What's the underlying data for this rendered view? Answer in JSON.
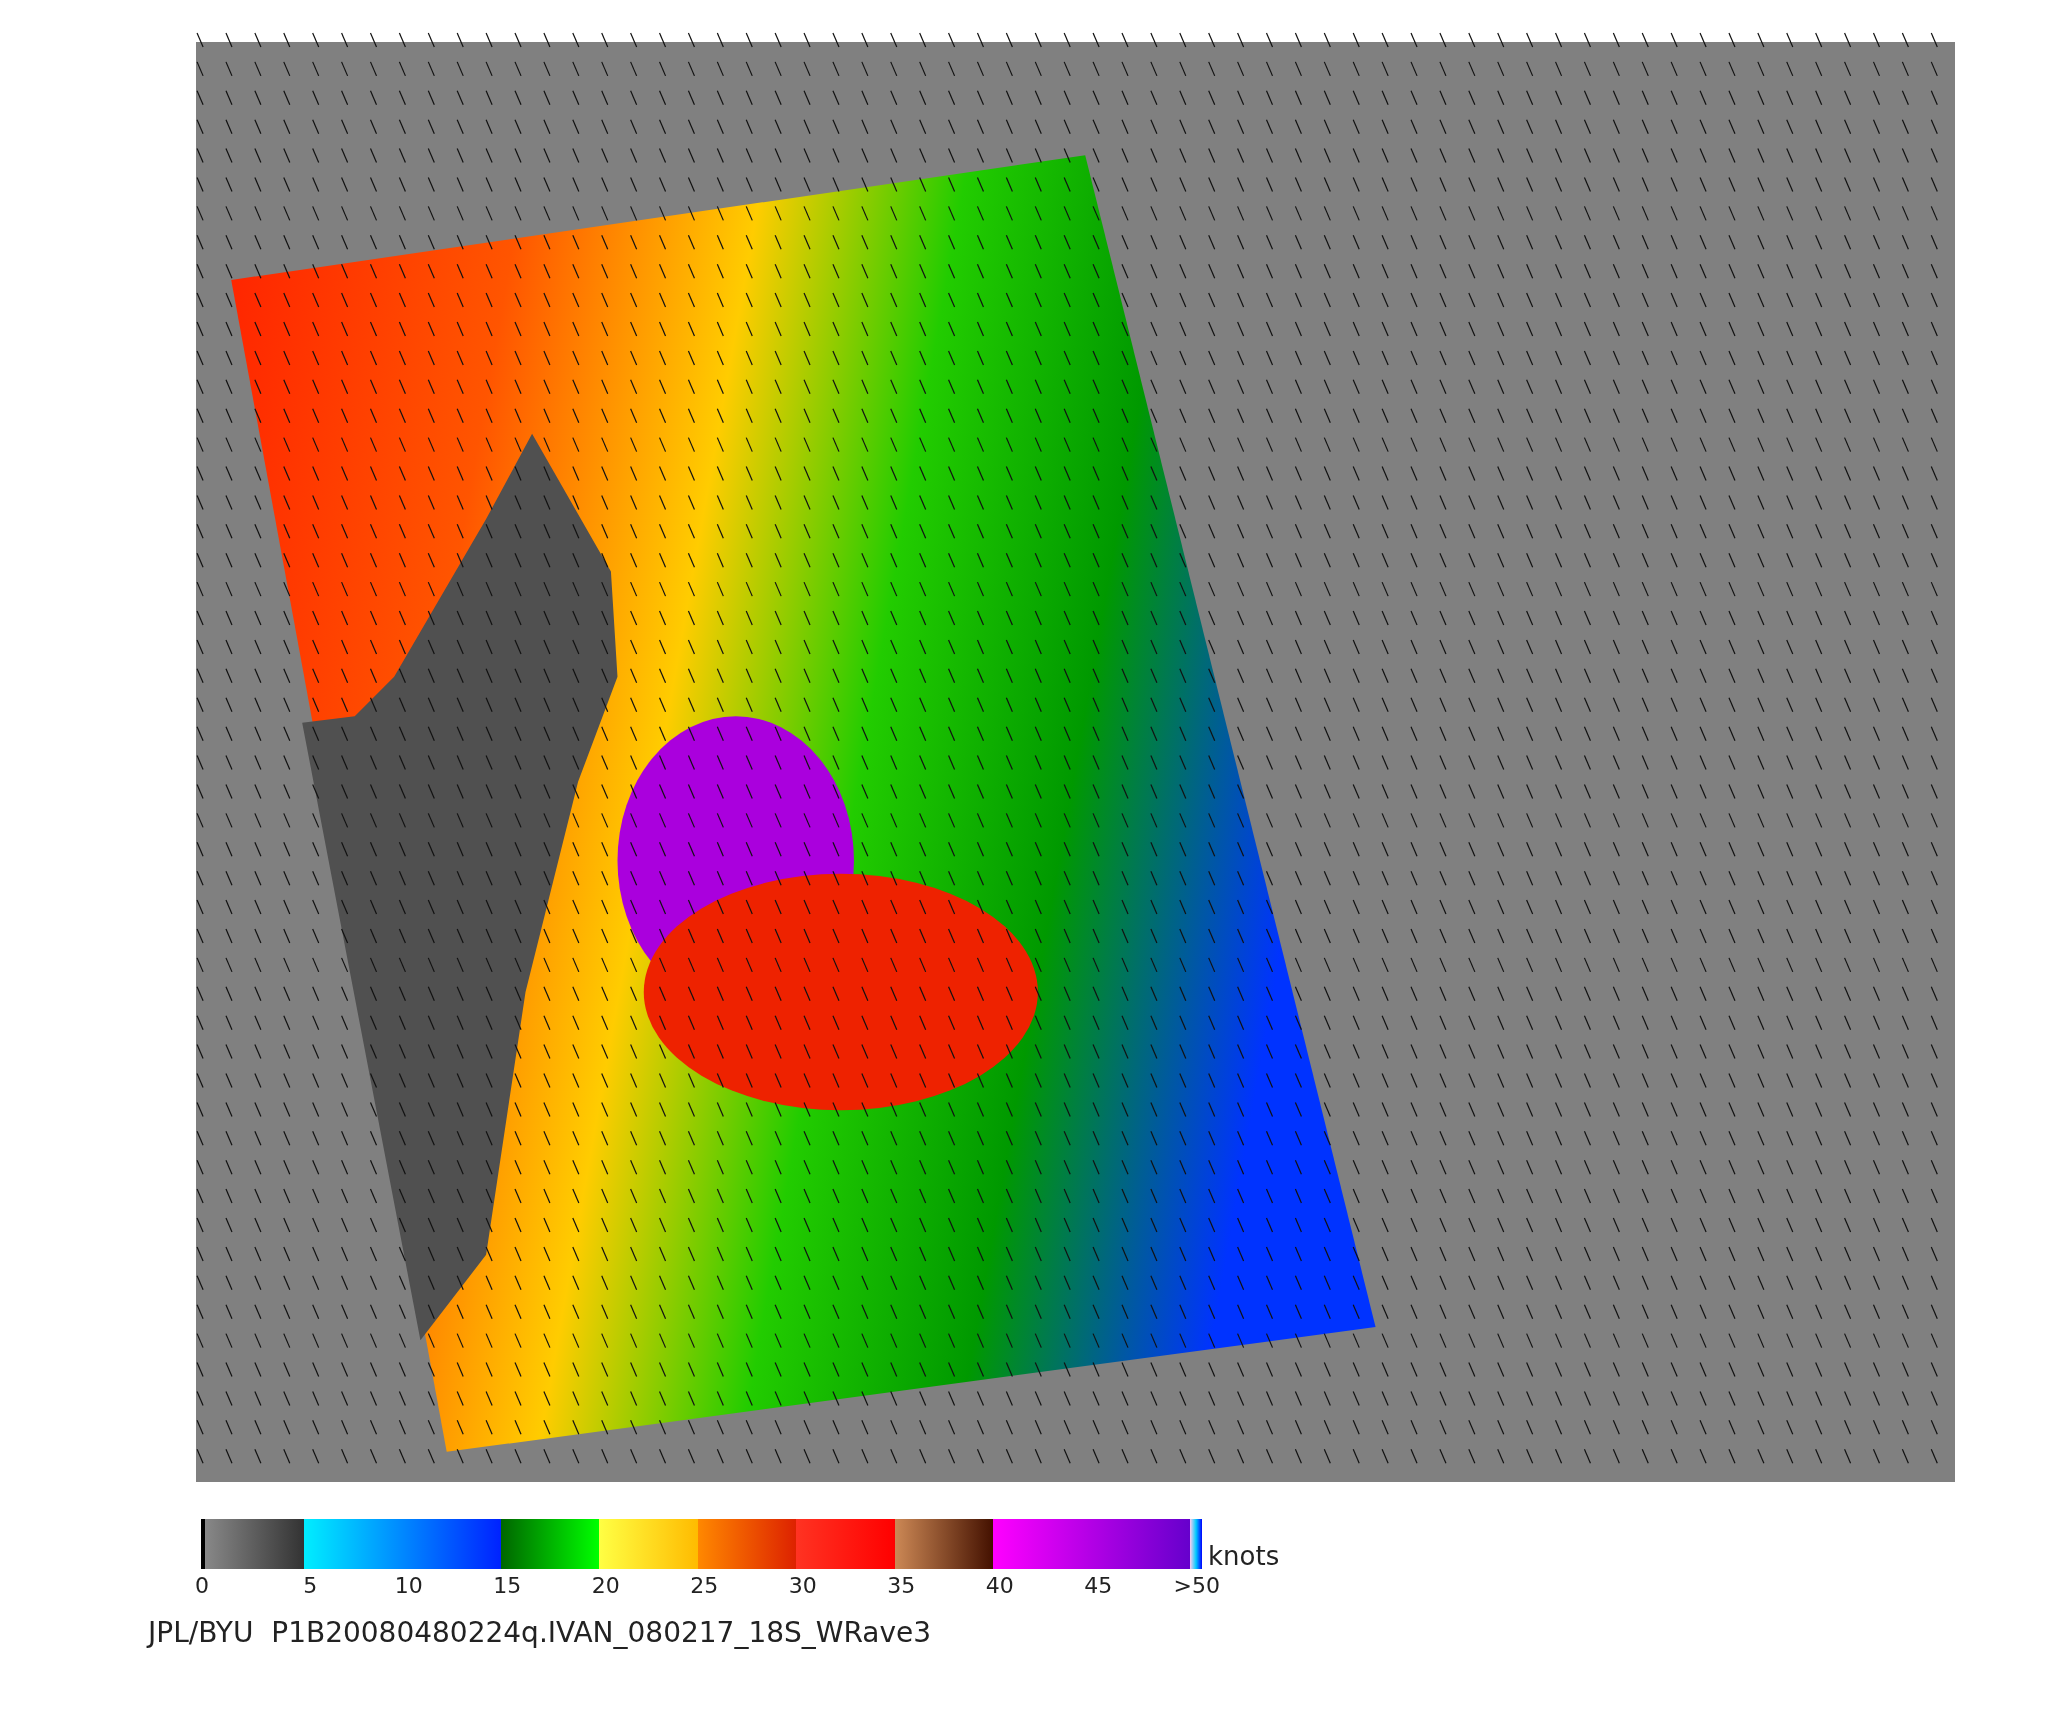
{
  "colorbar": {
    "unit": "knots",
    "ticks": [
      "0",
      "5",
      "10",
      "15",
      "20",
      "25",
      "30",
      "35",
      "40",
      "45",
      ">50"
    ]
  },
  "caption": "JPL/BYU  P1B20080480224q.IVAN_080217_18S_WRave3"
}
